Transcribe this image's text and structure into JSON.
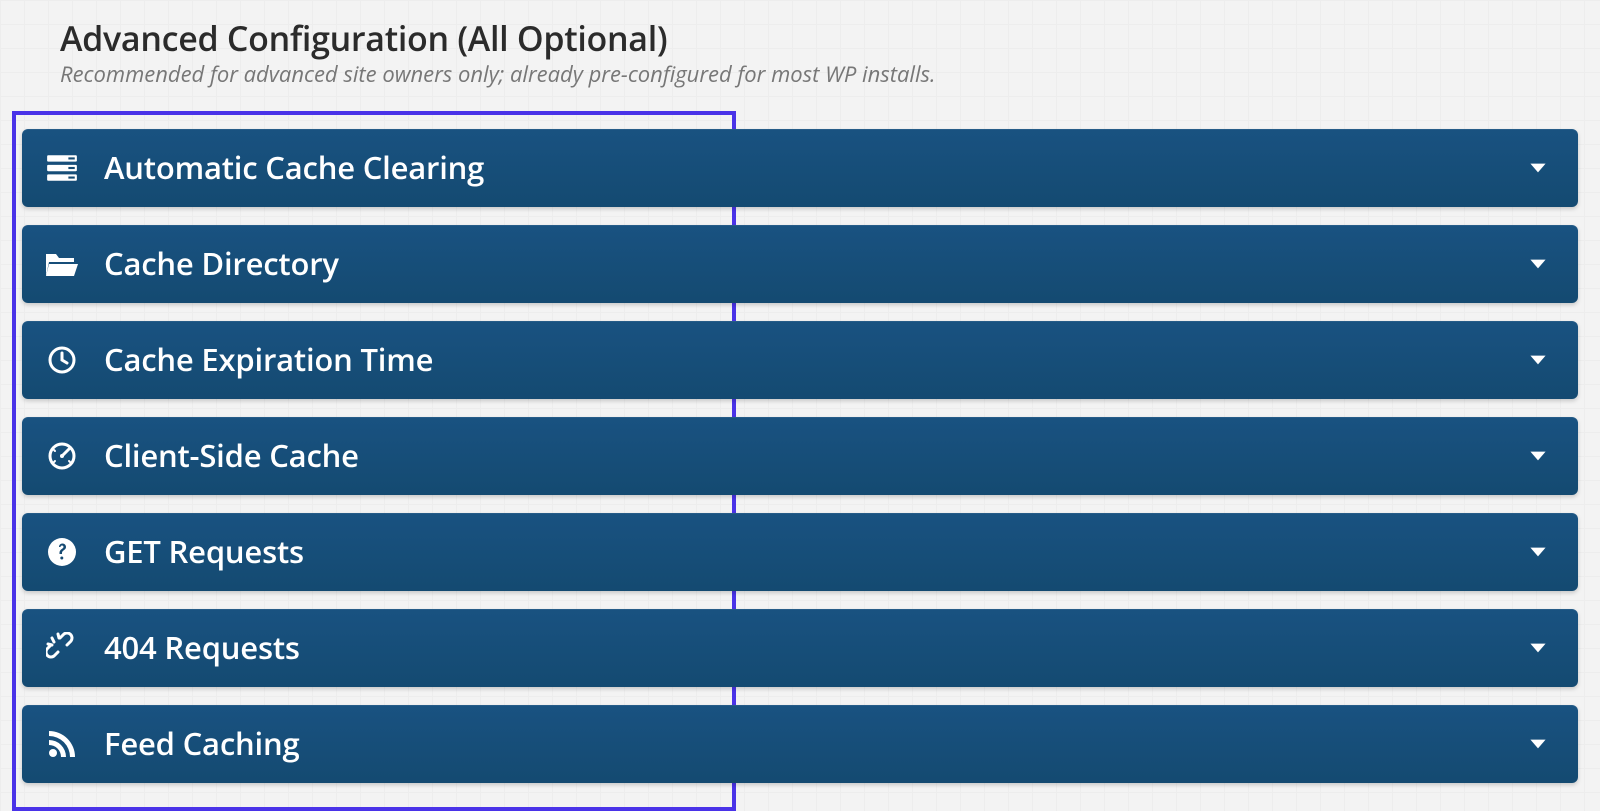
{
  "header": {
    "title": "Advanced Configuration (All Optional)",
    "subtitle": "Recommended for advanced site owners only; already pre-configured for most WP installs."
  },
  "panels": [
    {
      "icon": "server-icon",
      "label": "Automatic Cache Clearing"
    },
    {
      "icon": "folder-open-icon",
      "label": "Cache Directory"
    },
    {
      "icon": "clock-icon",
      "label": "Cache Expiration Time"
    },
    {
      "icon": "dashboard-icon",
      "label": "Client-Side Cache"
    },
    {
      "icon": "question-circle-icon",
      "label": "GET Requests"
    },
    {
      "icon": "broken-link-icon",
      "label": "404 Requests"
    },
    {
      "icon": "rss-icon",
      "label": "Feed Caching"
    }
  ],
  "colors": {
    "panel_bg": "#144a71",
    "highlight": "#4a33e8"
  }
}
